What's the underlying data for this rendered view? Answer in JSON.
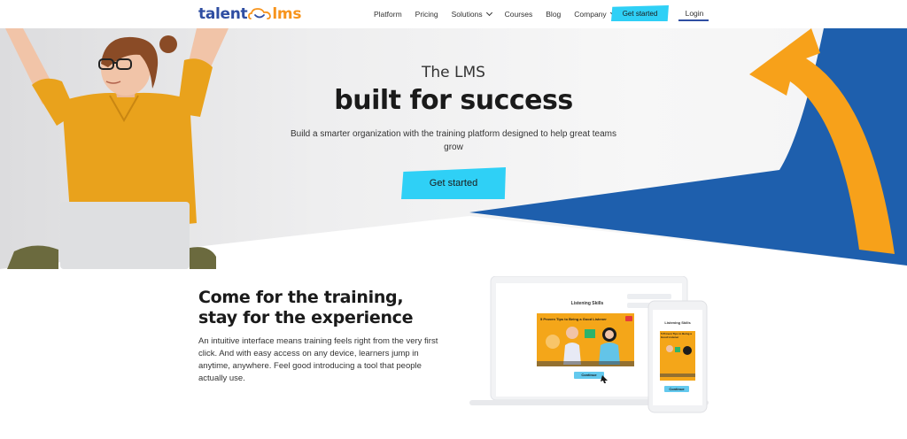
{
  "nav": {
    "logo_left": "talent",
    "logo_right": "lms",
    "links": [
      {
        "label": "Platform",
        "has_dropdown": false
      },
      {
        "label": "Pricing",
        "has_dropdown": false
      },
      {
        "label": "Solutions",
        "has_dropdown": true
      },
      {
        "label": "Courses",
        "has_dropdown": false
      },
      {
        "label": "Blog",
        "has_dropdown": false
      },
      {
        "label": "Company",
        "has_dropdown": true
      }
    ],
    "cta_label": "Get started",
    "login_label": "Login"
  },
  "hero": {
    "title_small": "The LMS",
    "title_big": "built for success",
    "subtitle": "Build a smarter organization with the training platform designed to help great teams grow",
    "cta_label": "Get started"
  },
  "section": {
    "title_line1": "Come for the training,",
    "title_line2": "stay for the experience",
    "body": "An intuitive interface means training feels right from the very first click. And with easy access on any device, learners jump in anytime, anywhere. Feel good introducing a tool that people actually use."
  },
  "mockup": {
    "laptop_header": "Listening Skills",
    "laptop_video_title": "5 Proven Tips to Being a Good Listener",
    "laptop_button": "Continue",
    "phone_header": "Listening Skills",
    "phone_video_title": "5 Proven Tips to Being a Good Listener",
    "phone_button": "Continue"
  },
  "colors": {
    "brand_blue": "#2f4ea2",
    "brand_orange": "#f7941d",
    "cta_cyan": "#2fd0f6",
    "hero_blue": "#1e5fad",
    "hero_yellow": "#f7a11a",
    "shirt_mustard": "#e9a21c"
  },
  "icons": [
    "chevron-down-icon",
    "cloud-logo-icon",
    "video-play-icon",
    "cursor-icon"
  ]
}
